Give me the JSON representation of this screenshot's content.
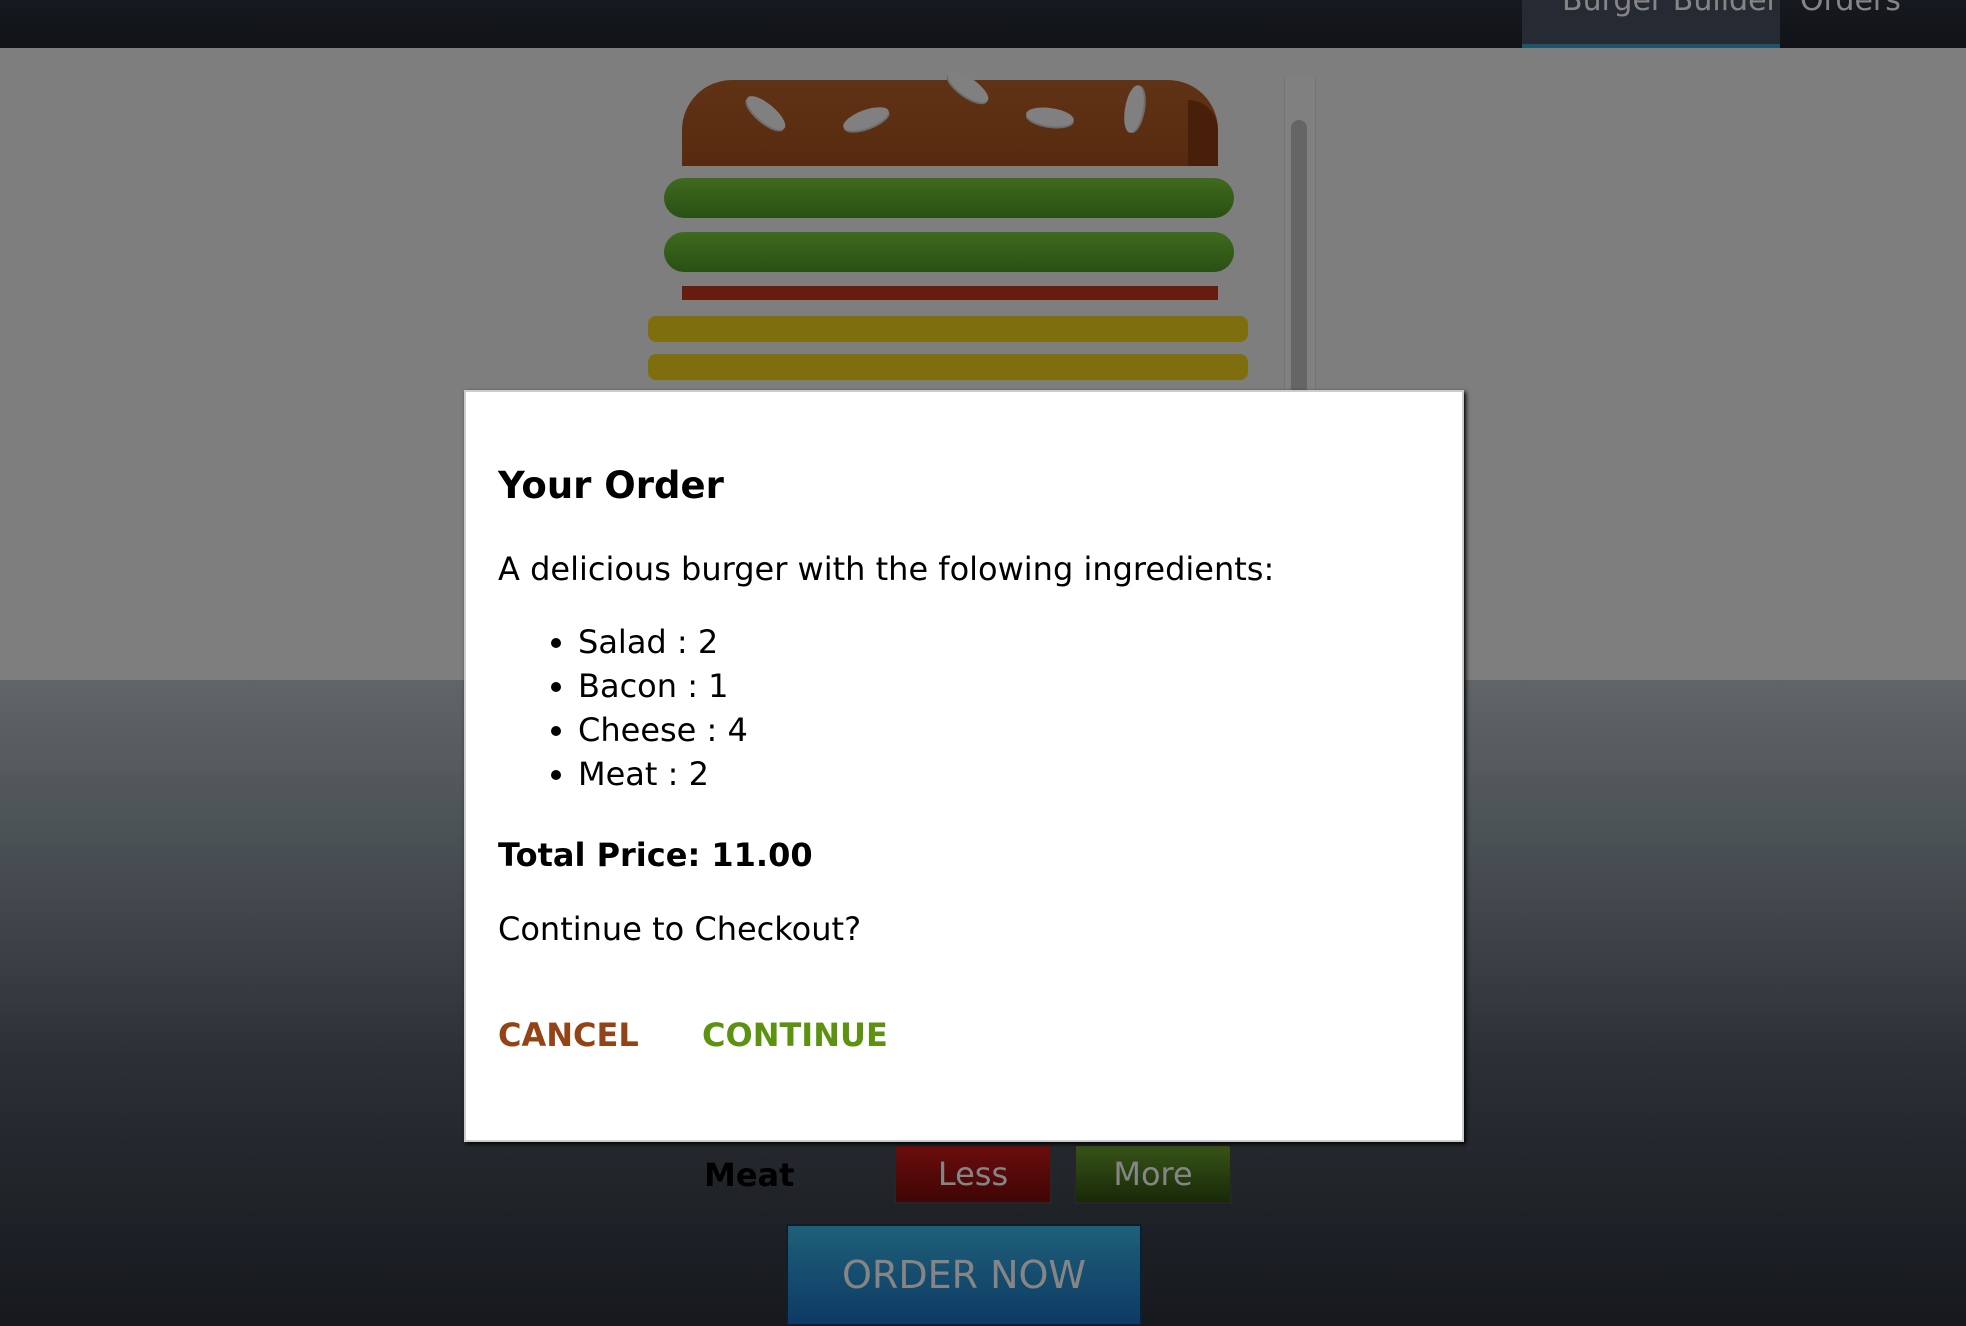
{
  "nav": {
    "burger_builder_label": "Burger Builder",
    "orders_label": "Orders"
  },
  "controls": {
    "meat_label": "Meat",
    "less_label": "Less",
    "more_label": "More",
    "order_now_label": "ORDER NOW"
  },
  "modal": {
    "title": "Your Order",
    "intro": "A delicious burger with the folowing ingredients:",
    "ingredients": [
      "Salad : 2",
      "Bacon : 1",
      "Cheese : 4",
      "Meat : 2"
    ],
    "total": "Total Price: 11.00",
    "question": "Continue to Checkout?",
    "cancel_label": "CANCEL",
    "continue_label": "CONTINUE"
  },
  "colors": {
    "cancel": "#944317",
    "continue": "#5c9210",
    "accent": "#40a0c8"
  }
}
